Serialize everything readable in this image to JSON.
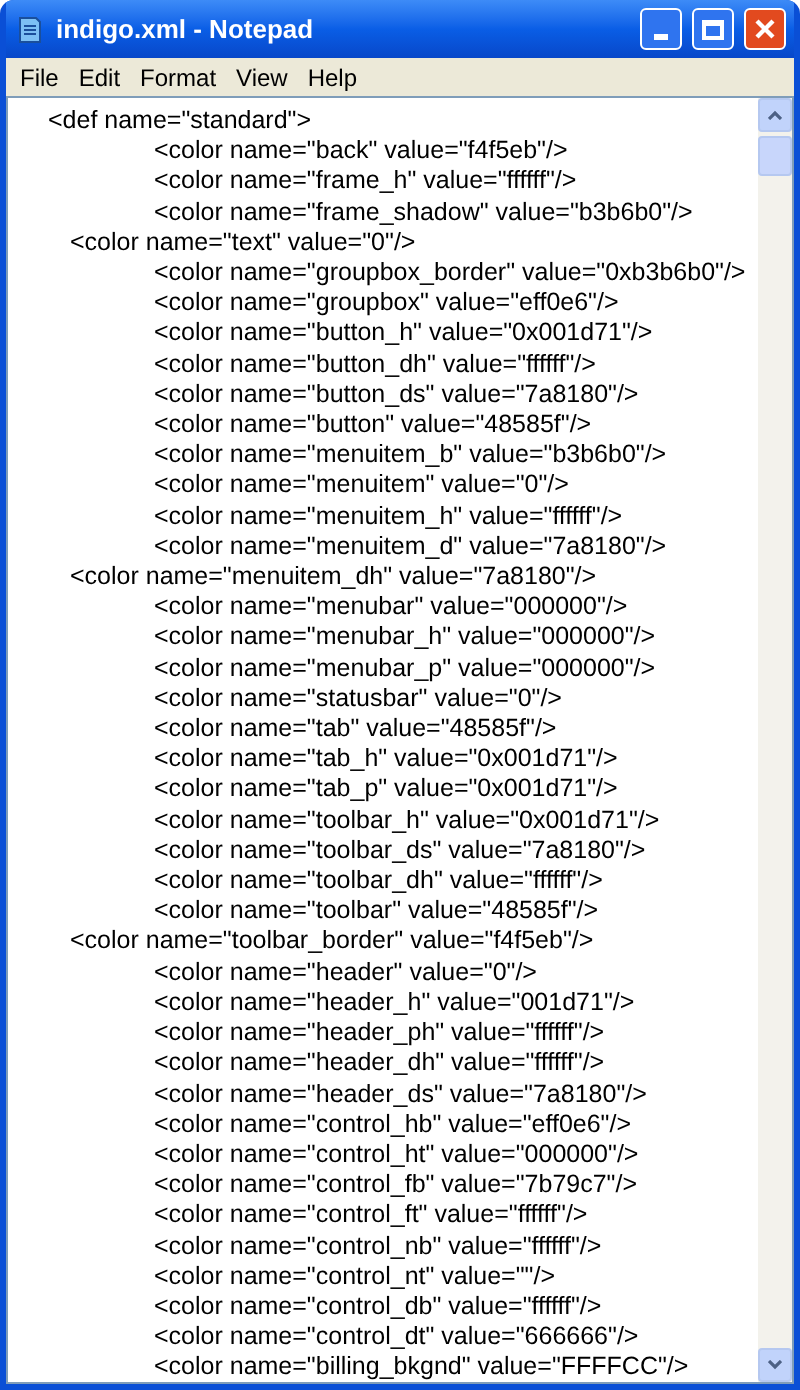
{
  "window": {
    "title": "indigo.xml - Notepad"
  },
  "menu": [
    "File",
    "Edit",
    "Format",
    "View",
    "Help"
  ],
  "lines": [
    {
      "kind": "def",
      "text": "<def name=\"standard\">"
    },
    {
      "kind": "inner",
      "text": "<color name=\"back\" value=\"f4f5eb\"/>"
    },
    {
      "kind": "inner",
      "text": "<color name=\"frame_h\" value=\"ffffff\"/>"
    },
    {
      "kind": "inner",
      "text": "<color name=\"frame_shadow\" value=\"b3b6b0\"/>"
    },
    {
      "kind": "outer",
      "text": "<color name=\"text\" value=\"0\"/>"
    },
    {
      "kind": "inner",
      "text": "<color name=\"groupbox_border\" value=\"0xb3b6b0\"/>"
    },
    {
      "kind": "inner",
      "text": "<color name=\"groupbox\" value=\"eff0e6\"/>"
    },
    {
      "kind": "inner",
      "text": "<color name=\"button_h\" value=\"0x001d71\"/>"
    },
    {
      "kind": "inner",
      "text": "<color name=\"button_dh\" value=\"ffffff\"/>"
    },
    {
      "kind": "inner",
      "text": "<color name=\"button_ds\" value=\"7a8180\"/>"
    },
    {
      "kind": "inner",
      "text": "<color name=\"button\" value=\"48585f\"/>"
    },
    {
      "kind": "inner",
      "text": "<color name=\"menuitem_b\" value=\"b3b6b0\"/>"
    },
    {
      "kind": "inner",
      "text": "<color name=\"menuitem\" value=\"0\"/>"
    },
    {
      "kind": "inner",
      "text": "<color name=\"menuitem_h\" value=\"ffffff\"/>"
    },
    {
      "kind": "inner",
      "text": "<color name=\"menuitem_d\" value=\"7a8180\"/>"
    },
    {
      "kind": "outer",
      "text": "<color name=\"menuitem_dh\" value=\"7a8180\"/>"
    },
    {
      "kind": "inner",
      "text": "<color name=\"menubar\" value=\"000000\"/>"
    },
    {
      "kind": "inner",
      "text": "<color name=\"menubar_h\" value=\"000000\"/>"
    },
    {
      "kind": "inner",
      "text": "<color name=\"menubar_p\" value=\"000000\"/>"
    },
    {
      "kind": "inner",
      "text": "<color name=\"statusbar\" value=\"0\"/>"
    },
    {
      "kind": "inner",
      "text": "<color name=\"tab\" value=\"48585f\"/>"
    },
    {
      "kind": "inner",
      "text": "<color name=\"tab_h\" value=\"0x001d71\"/>"
    },
    {
      "kind": "inner",
      "text": "<color name=\"tab_p\" value=\"0x001d71\"/>"
    },
    {
      "kind": "inner",
      "text": "<color name=\"toolbar_h\" value=\"0x001d71\"/>"
    },
    {
      "kind": "inner",
      "text": "<color name=\"toolbar_ds\" value=\"7a8180\"/>"
    },
    {
      "kind": "inner",
      "text": "<color name=\"toolbar_dh\" value=\"ffffff\"/>"
    },
    {
      "kind": "inner",
      "text": "<color name=\"toolbar\" value=\"48585f\"/>"
    },
    {
      "kind": "outer",
      "text": "<color name=\"toolbar_border\" value=\"f4f5eb\"/>"
    },
    {
      "kind": "inner",
      "text": "<color name=\"header\" value=\"0\"/>"
    },
    {
      "kind": "inner",
      "text": "<color name=\"header_h\" value=\"001d71\"/>"
    },
    {
      "kind": "inner",
      "text": "<color name=\"header_ph\" value=\"ffffff\"/>"
    },
    {
      "kind": "inner",
      "text": "<color name=\"header_dh\" value=\"ffffff\"/>"
    },
    {
      "kind": "inner",
      "text": "<color name=\"header_ds\" value=\"7a8180\"/>"
    },
    {
      "kind": "inner",
      "text": "<color name=\"control_hb\" value=\"eff0e6\"/>"
    },
    {
      "kind": "inner",
      "text": "<color name=\"control_ht\" value=\"000000\"/>"
    },
    {
      "kind": "inner",
      "text": "<color name=\"control_fb\" value=\"7b79c7\"/>"
    },
    {
      "kind": "inner",
      "text": "<color name=\"control_ft\" value=\"ffffff\"/>"
    },
    {
      "kind": "inner",
      "text": "<color name=\"control_nb\" value=\"ffffff\"/>"
    },
    {
      "kind": "inner",
      "text": "<color name=\"control_nt\" value=\"\"/>"
    },
    {
      "kind": "inner",
      "text": "<color name=\"control_db\" value=\"ffffff\"/>"
    },
    {
      "kind": "inner",
      "text": "<color name=\"control_dt\" value=\"666666\"/>"
    },
    {
      "kind": "inner",
      "text": "<color name=\"billing_bkgnd\" value=\"FFFFCC\"/>"
    }
  ]
}
